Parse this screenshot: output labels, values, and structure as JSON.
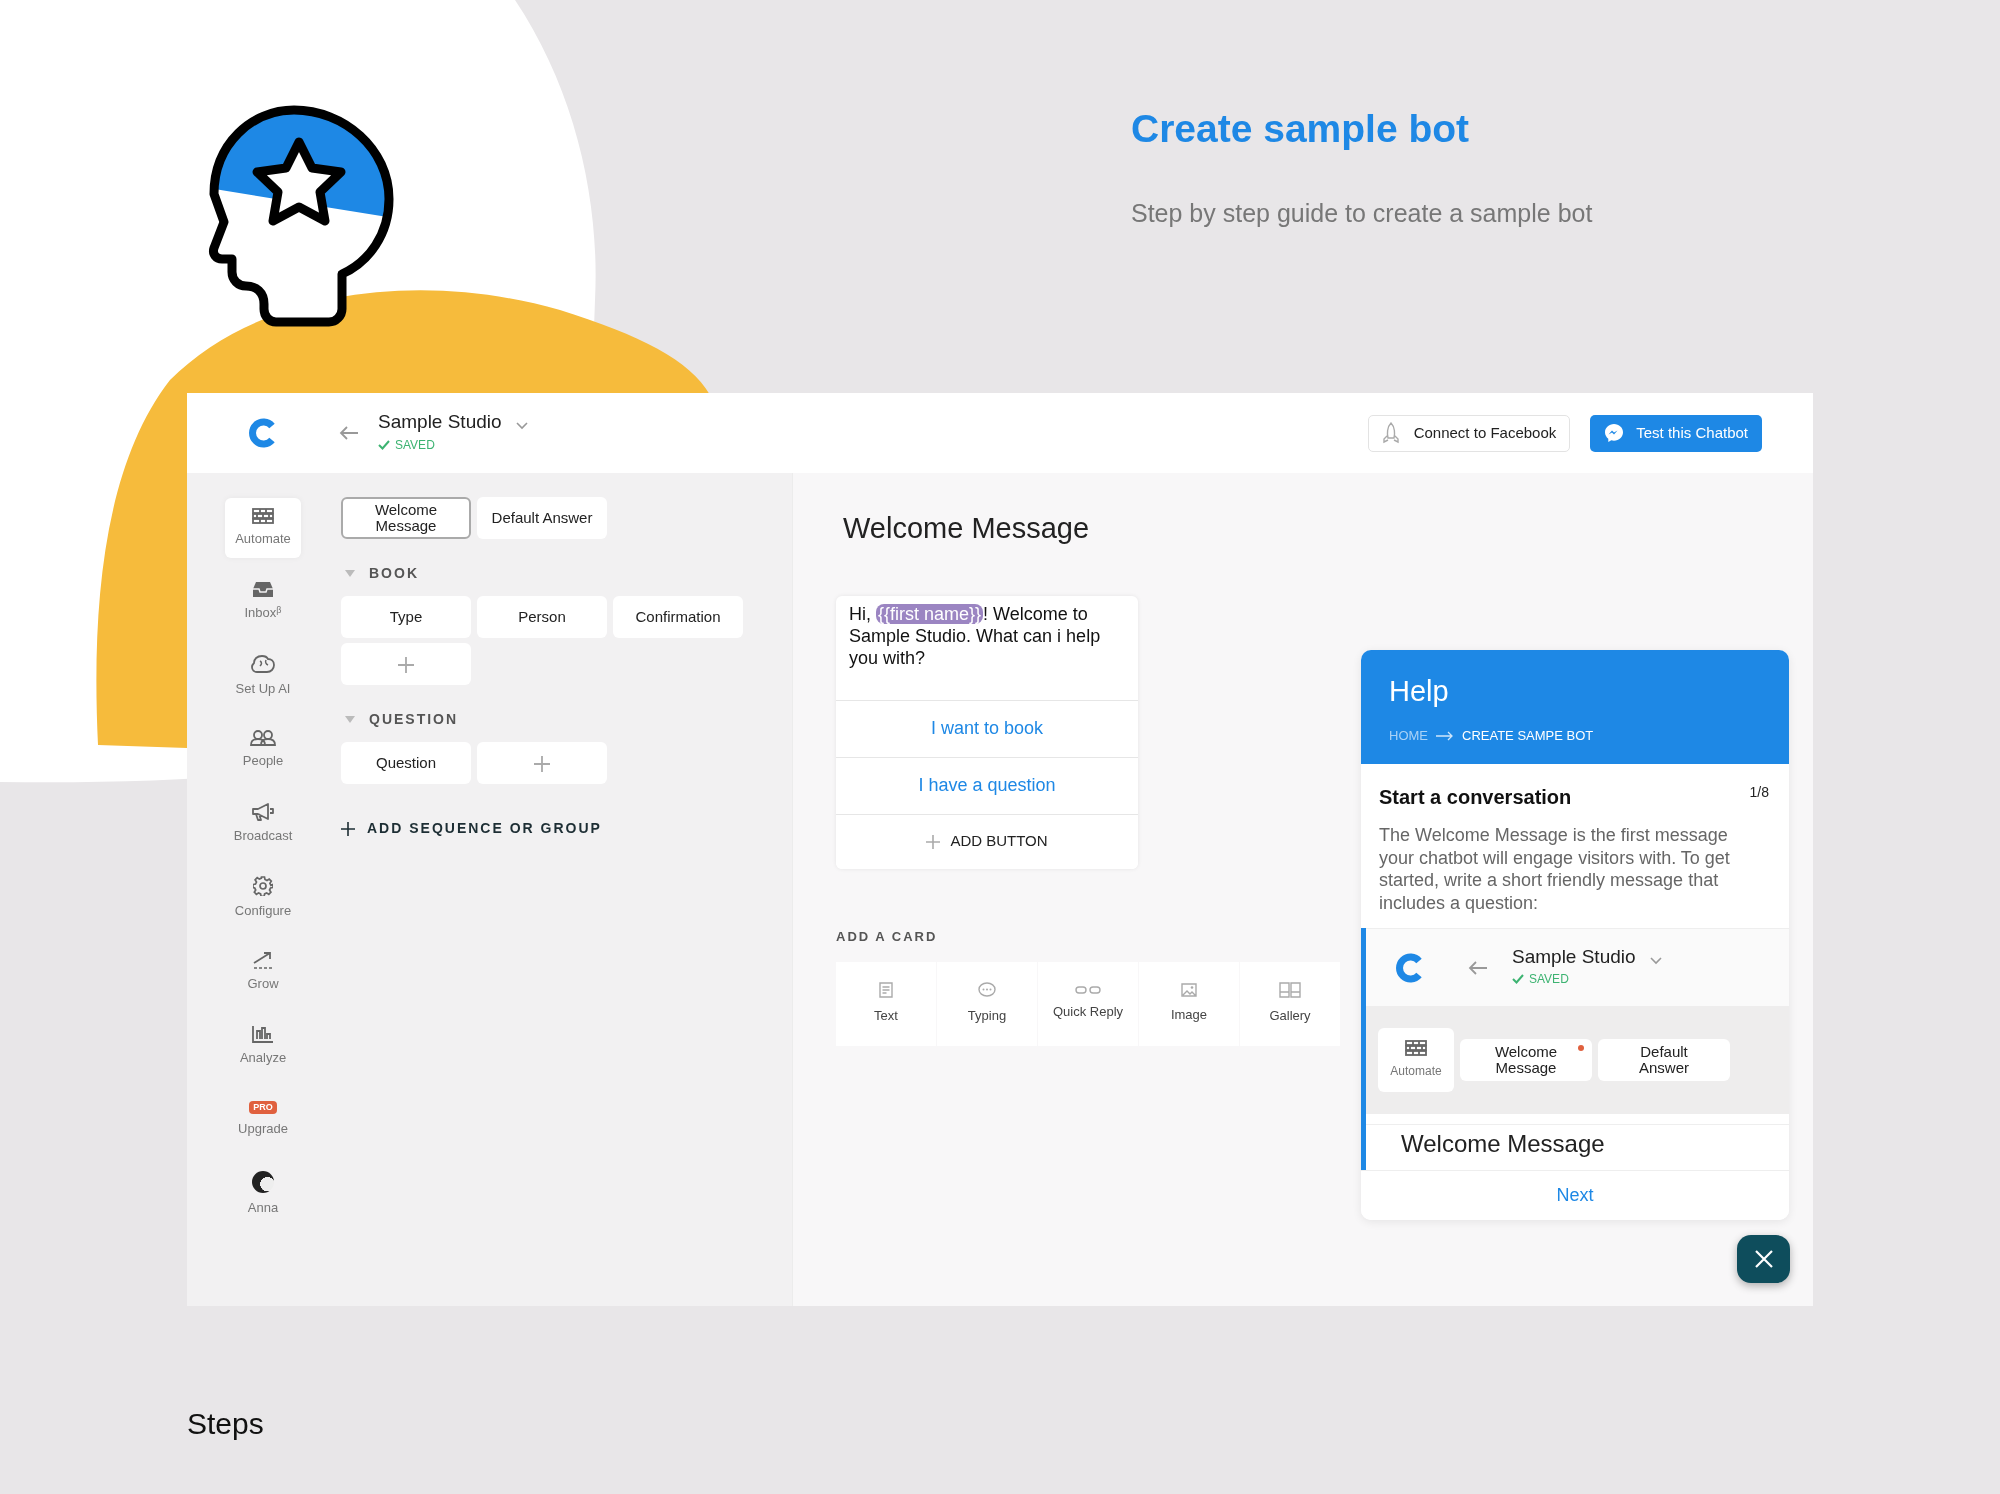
{
  "hero": {
    "title": "Create sample bot",
    "subtitle": "Step by step guide to create a sample bot"
  },
  "app": {
    "header": {
      "studio_name": "Sample Studio",
      "status": "SAVED",
      "connect_button": "Connect to Facebook",
      "test_button": "Test this Chatbot"
    },
    "nav": [
      {
        "kind": "icon",
        "label": "Automate",
        "selected": true
      },
      {
        "kind": "icon",
        "label": "Inbox$^{β}$",
        "selected": false
      },
      {
        "kind": "icon",
        "label": "Set Up AI",
        "selected": false
      },
      {
        "kind": "icon",
        "label": "People",
        "selected": false
      },
      {
        "kind": "icon",
        "label": "Broadcast",
        "selected": false
      },
      {
        "kind": "icon",
        "label": "Configure",
        "selected": false
      },
      {
        "kind": "icon",
        "label": "Grow",
        "selected": false
      },
      {
        "kind": "icon",
        "label": "Analyze",
        "selected": false
      },
      {
        "kind": "badge",
        "badge": "PRO",
        "label": "Upgrade",
        "selected": false
      },
      {
        "kind": "avatar",
        "label": "Anna",
        "selected": false
      }
    ],
    "sequences": {
      "pinned": [
        {
          "label": "Welcome Message",
          "selected": true
        },
        {
          "label": "Default Answer",
          "selected": false
        }
      ],
      "groups": [
        {
          "title": "BOOK",
          "expanded": true,
          "items": [
            "Type",
            "Person",
            "Confirmation"
          ]
        },
        {
          "title": "QUESTION",
          "expanded": true,
          "items": [
            "Question"
          ]
        }
      ],
      "add_group": "ADD SEQUENCE OR GROUP"
    },
    "editor": {
      "title": "Welcome Message",
      "message": {
        "before": "Hi, ",
        "variable": "{{first name}}",
        "after": "! Welcome to Sample Studio. What can i help you with?"
      },
      "replies": [
        "I want to book",
        "I have a question"
      ],
      "add_button": "ADD BUTTON",
      "add_card_label": "ADD A CARD",
      "card_types": [
        "Text",
        "Typing",
        "Quick Reply",
        "Image",
        "Gallery"
      ]
    },
    "help": {
      "title": "Help",
      "breadcrumb": [
        "HOME",
        "CREATE SAMPE BOT"
      ],
      "step_title": "Start a conversation",
      "step_counter": "1/8",
      "body": "The Welcome Message is the first message your chatbot will engage visitors with. To get started, write a short friendly message that includes a question:",
      "preview": {
        "studio_name": "Sample Studio",
        "status": "SAVED",
        "nav_label": "Automate",
        "tabs": [
          {
            "label": "Welcome Message",
            "marked": true
          },
          {
            "label": "Default Answer",
            "marked": false
          }
        ],
        "heading": "Welcome Message"
      },
      "next": "Next"
    }
  },
  "footer": {
    "heading": "Steps"
  }
}
